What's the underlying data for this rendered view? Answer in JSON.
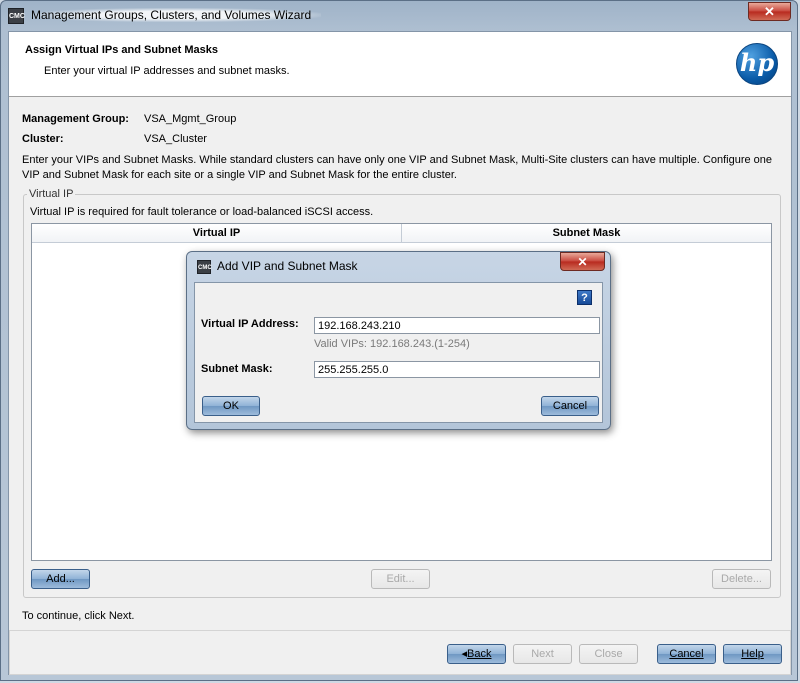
{
  "window": {
    "title": "Management Groups, Clusters, and Volumes Wizard",
    "app_icon": "CMC",
    "close_glyph": "✕"
  },
  "header": {
    "title": "Assign Virtual IPs and Subnet Masks",
    "subtitle": "Enter your virtual IP addresses and subnet masks.",
    "logo_text": "hp"
  },
  "info": {
    "mgmt_group_label": "Management Group:",
    "mgmt_group_value": "VSA_Mgmt_Group",
    "cluster_label": "Cluster:",
    "cluster_value": "VSA_Cluster",
    "description": "Enter your VIPs and Subnet Masks. While standard clusters can have only one VIP and Subnet Mask, Multi-Site clusters can have multiple. Configure one VIP and Subnet Mask for each site or a single VIP and Subnet Mask for the entire cluster."
  },
  "vip_group": {
    "legend": "Virtual IP",
    "description": "Virtual IP is required for fault tolerance or load-balanced iSCSI access.",
    "columns": [
      "Virtual IP",
      "Subnet Mask"
    ],
    "add_label": "Add...",
    "edit_label": "Edit...",
    "delete_label": "Delete..."
  },
  "footer": {
    "hint": "To continue, click Next.",
    "back_label": "Back",
    "next_label": "Next",
    "close_label": "Close",
    "cancel_label": "Cancel",
    "help_label": "Help"
  },
  "dialog": {
    "title": "Add VIP and Subnet Mask",
    "help_glyph": "?",
    "vip_label": "Virtual IP Address:",
    "vip_value": "192.168.243.210",
    "vip_hint": "Valid VIPs:  192.168.243.(1-254)",
    "mask_label": "Subnet Mask:",
    "mask_value": "255.255.255.0",
    "ok_label": "OK",
    "cancel_label": "Cancel"
  },
  "colors": {
    "button_blue": "#8fb2d6",
    "close_red": "#c7453a",
    "hp_blue": "#0a5ba8"
  }
}
